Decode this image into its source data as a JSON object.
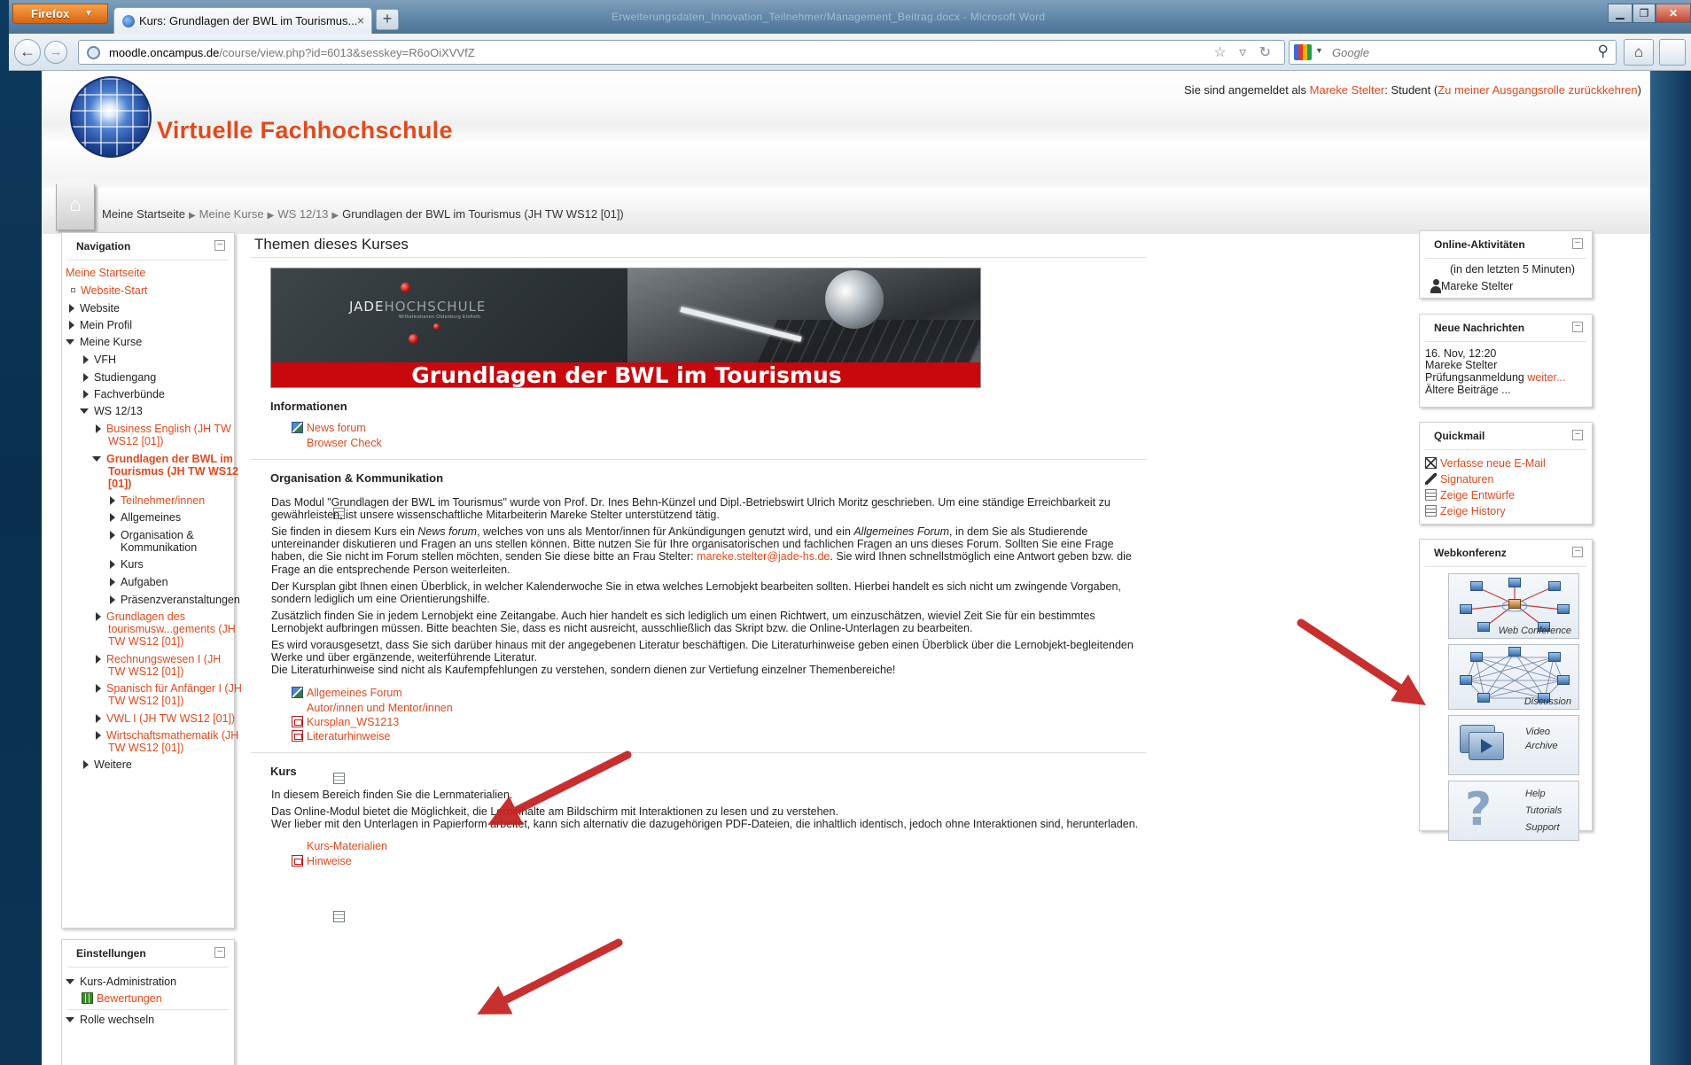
{
  "browser": {
    "menu_label": "Firefox",
    "tab_title": "Kurs: Grundlagen der BWL im Tourismus...",
    "window_title": "Erweiterungsdaten_Innovation_Teilnehmer/Management_Beitrag.docx - Microsoft Word",
    "url_host": "moodle.oncampus.de",
    "url_path": "/course/view.php?id=6013&sesskey=R6oOiXVVfZ",
    "search_placeholder": "Google"
  },
  "header": {
    "site_title": "Virtuelle Fachhochschule",
    "login_prefix": "Sie sind angemeldet als ",
    "login_user": "Mareke Stelter",
    "login_role": ": Student (",
    "login_return": "Zu meiner Ausgangsrolle zurückkehren",
    "login_suffix": ")"
  },
  "breadcrumb": [
    "Meine Startseite",
    "Meine Kurse",
    "WS 12/13",
    "Grundlagen der BWL im Tourismus (JH TW WS12 [01])"
  ],
  "navigation": {
    "title": "Navigation",
    "home": "Meine Startseite",
    "website_start": "Website-Start",
    "website": "Website",
    "profile": "Mein Profil",
    "courses": "Meine Kurse",
    "vfh": "VFH",
    "studiengang": "Studiengang",
    "fachverbuende": "Fachverbünde",
    "ws1213": "WS 12/13",
    "business_english_1": "Business English (JH TW",
    "business_english_2": "WS12 [01])",
    "current_1": "Grundlagen der BWL im",
    "current_2": "Tourismus (JH TW WS12",
    "current_3": "[01])",
    "participants": "Teilnehmer/innen",
    "allgemeines": "Allgemeines",
    "org_1": "Organisation &",
    "org_2": "Kommunikation",
    "kurs": "Kurs",
    "aufgaben": "Aufgaben",
    "praesenz": "Präsenzveranstaltungen",
    "tour_1": "Grundlagen des",
    "tour_2": "tourismusw...gements (JH",
    "tour_3": "TW WS12 [01])",
    "rechnung_1": "Rechnungswesen I (JH",
    "rechnung_2": "TW WS12 [01])",
    "spanisch_1": "Spanisch für Anfänger I (JH",
    "spanisch_2": "TW WS12 [01])",
    "vwl": "VWL I (JH TW WS12 [01])",
    "wima_1": "Wirtschaftsmathematik (JH",
    "wima_2": "TW WS12 [01])",
    "weitere": "Weitere"
  },
  "settings": {
    "title": "Einstellungen",
    "kurs_admin": "Kurs-Administration",
    "bewertungen": "Bewertungen",
    "rolle": "Rolle wechseln"
  },
  "main": {
    "title": "Themen dieses Kurses",
    "banner_brand_a": "JADE",
    "banner_brand_b": "HOCHSCHULE",
    "banner_brand_sub": "Wilhelmshaven Oldenburg Elsfleth",
    "banner_title": "Grundlagen der BWL im Tourismus",
    "info_title": "Informationen",
    "news_forum": "News forum",
    "browser_check": "Browser Check",
    "org_title": "Organisation & Kommunikation",
    "p1": "Das Modul \"Grundlagen der BWL im Tourismus\" wurde von Prof. Dr. Ines Behn-Künzel und Dipl.-Betriebswirt Ulrich Moritz geschrieben. Um eine ständige Erreichbarkeit zu gewährleisten, ist unsere wissenschaftliche Mitarbeiterin Mareke Stelter unterstützend tätig.",
    "p2a": "Sie finden in diesem Kurs ein ",
    "p2b": "News forum",
    "p2c": ", welches von uns als Mentor/innen für Ankündigungen genutzt wird, und ein ",
    "p2d": "Allgemeines Forum",
    "p2e": ", in dem Sie als Studierende untereinander diskutieren und Fragen an uns stellen können. Bitte nutzen Sie für Ihre organisatorischen und fachlichen Fragen an uns dieses Forum. Sollten Sie eine Frage haben, die Sie nicht im Forum stellen möchten, senden Sie diese bitte an Frau Stelter: ",
    "p2_email": "mareke.stelter@jade-hs.de",
    "p2f": ". Sie wird Ihnen schnellstmöglich eine Antwort geben bzw. die Frage an die entsprechende Person weiterleiten.",
    "p3": "Der Kursplan gibt Ihnen einen Überblick, in welcher Kalenderwoche Sie in etwa welches Lernobjekt bearbeiten sollten. Hierbei handelt es sich nicht um zwingende Vorgaben, sondern lediglich um eine Orientierungshilfe.",
    "p4": "Zusätzlich finden Sie in jedem Lernobjekt eine Zeitangabe. Auch hier handelt es sich lediglich um einen Richtwert, um einzuschätzen, wieviel Zeit Sie für ein bestimmtes Lernobjekt aufbringen müssen. Bitte beachten Sie, dass es nicht ausreicht, ausschließlich das Skript bzw. die Online-Unterlagen zu bearbeiten.",
    "p5": "Es wird vorausgesetzt, dass Sie sich darüber hinaus mit der angegebenen Literatur beschäftigen. Die Literaturhinweise geben einen Überblick über die Lernobjekt-begleitenden Werke und über ergänzende, weiterführende Literatur.",
    "p6": "Die Literaturhinweise sind nicht als Kaufempfehlungen zu verstehen, sondern dienen zur Vertiefung einzelner Themenbereiche!",
    "allg_forum": "Allgemeines Forum",
    "autoren": "Autor/innen und Mentor/innen",
    "kursplan": "Kursplan_WS1213",
    "literatur": "Literaturhinweise",
    "kurs_title": "Kurs",
    "k1": "In diesem Bereich finden Sie die Lernmaterialien.",
    "k2": "Das Online-Modul bietet die Möglichkeit, die Lerninhalte am Bildschirm mit Interaktionen zu lesen und zu verstehen.",
    "k3": "Wer lieber mit den Unterlagen in Papierform arbeitet, kann sich alternativ die dazugehörigen PDF-Dateien, die inhaltlich identisch, jedoch ohne Interaktionen sind, herunterladen.",
    "kurs_materialien": "Kurs-Materialien",
    "hinweise": "Hinweise"
  },
  "online": {
    "title": "Online-Aktivitäten",
    "range": "(in den letzten 5 Minuten)",
    "user": "Mareke Stelter"
  },
  "news": {
    "title": "Neue Nachrichten",
    "date": "16. Nov, 12:20",
    "author": "Mareke Stelter",
    "subject": "Prüfungsanmeldung",
    "more": "weiter...",
    "older": "Ältere Beiträge ..."
  },
  "quickmail": {
    "title": "Quickmail",
    "compose": "Verfasse neue E-Mail",
    "signatures": "Signaturen",
    "drafts": "Zeige Entwürfe",
    "history": "Zeige History"
  },
  "webconf": {
    "title": "Webkonferenz",
    "web_conference": "Web Conference",
    "discussion": "Discussion",
    "video_1": "Video",
    "video_2": "Archive",
    "help_1": "Help",
    "help_2": "Tutorials",
    "help_3": "Support"
  },
  "colors": {
    "link": "#e2491c",
    "banner_red": "#c8080c",
    "arrow": "#c41e1e"
  }
}
